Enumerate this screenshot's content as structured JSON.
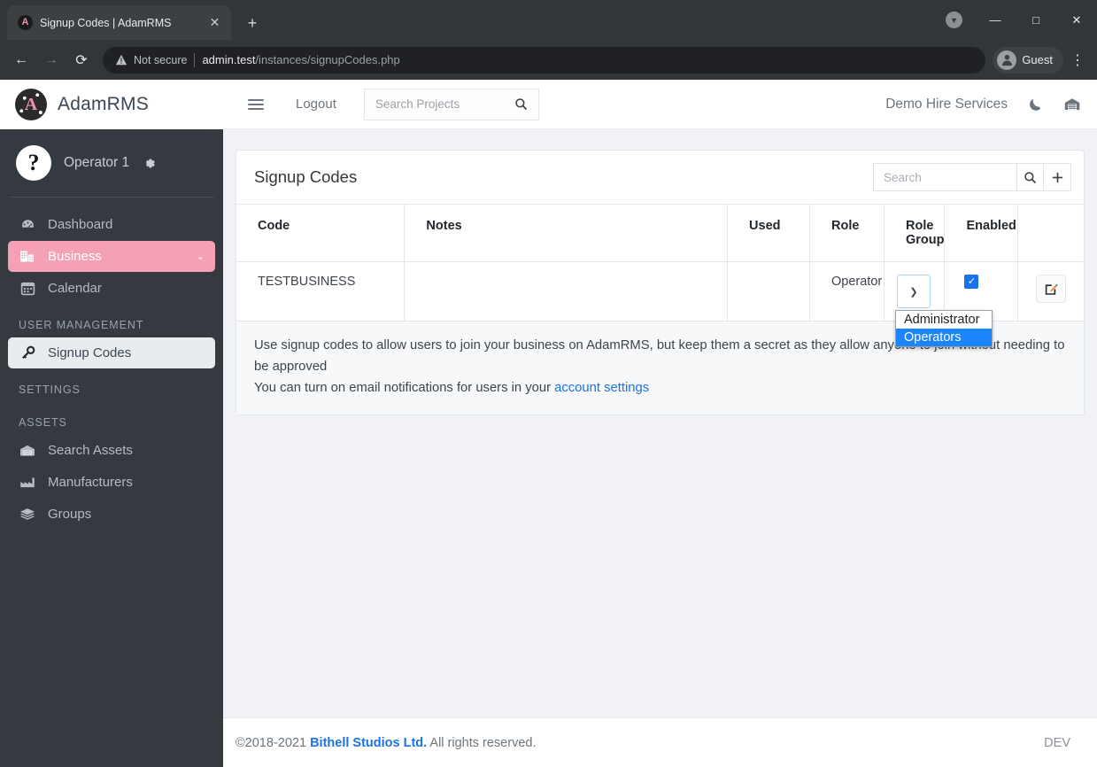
{
  "browser": {
    "tab": {
      "title": "Signup Codes | AdamRMS",
      "favicon_letter": "A",
      "close_icon": "close-icon"
    },
    "newtab_label": "+",
    "window": {
      "minimize": "—",
      "maximize": "□",
      "close": "✕",
      "update_icon": "update-dot-icon"
    },
    "nav": {
      "back": "←",
      "forward": "→",
      "reload": "⟳"
    },
    "omnibox": {
      "security_text": "Not secure",
      "url_host": "admin.test",
      "url_path": "/instances/signupCodes.php"
    },
    "profile_name": "Guest",
    "kebab_label": "⋮"
  },
  "sidebar": {
    "brand": {
      "name": "AdamRMS",
      "logo_letter": "A"
    },
    "user": {
      "name": "Operator 1",
      "avatar_glyph": "?",
      "settings_icon": "gear-icon"
    },
    "items": [
      {
        "label": "Dashboard",
        "icon": "dashboard-icon",
        "state": "normal"
      },
      {
        "label": "Business",
        "icon": "building-icon",
        "state": "active-pink",
        "chevron": "⌄"
      },
      {
        "label": "Calendar",
        "icon": "calendar-icon",
        "state": "normal"
      }
    ],
    "sections": [
      {
        "heading": "USER MANAGEMENT",
        "items": [
          {
            "label": "Signup Codes",
            "icon": "key-icon",
            "state": "active-light"
          }
        ]
      },
      {
        "heading": "SETTINGS",
        "items": []
      },
      {
        "heading": "ASSETS",
        "items": [
          {
            "label": "Search Assets",
            "icon": "warehouse-icon",
            "state": "normal"
          },
          {
            "label": "Manufacturers",
            "icon": "factory-icon",
            "state": "normal"
          },
          {
            "label": "Groups",
            "icon": "layers-icon",
            "state": "normal"
          }
        ]
      }
    ]
  },
  "topnav": {
    "menu_icon": "hamburger-icon",
    "logout_label": "Logout",
    "project_search_placeholder": "Search Projects",
    "search_icon": "search-icon",
    "business_name": "Demo Hire Services",
    "dark_mode_icon": "moon-icon",
    "venue_icon": "warehouse-icon"
  },
  "card": {
    "title": "Signup Codes",
    "search_placeholder": "Search",
    "search_value": "",
    "search_icon": "search-icon",
    "add_icon": "plus-icon",
    "columns": [
      "Code",
      "Notes",
      "Used",
      "Role",
      "Role Group",
      "Enabled",
      ""
    ],
    "rows": [
      {
        "code": "TESTBUSINESS",
        "notes": "",
        "used": "",
        "role": "Operator",
        "role_group_value": "",
        "enabled": true,
        "edit_icon": "edit-icon"
      }
    ],
    "dropdown": {
      "open": true,
      "options": [
        "Administrator",
        "Operators"
      ],
      "selected": "Operators"
    },
    "help_line1": "Use signup codes to allow users to join your business on AdamRMS, but keep them a secret as they allow anyone to join without needing to be approved",
    "help_line2_prefix": "You can turn on email notifications for users in your ",
    "help_link": "account settings"
  },
  "footer": {
    "copyright": "©2018-2021 ",
    "company": "Bithell Studios Ltd.",
    "rights": " All rights reserved.",
    "env": "DEV"
  },
  "colors": {
    "accent_pink": "#f4a0b5",
    "sidebar_bg": "#343a40",
    "link_blue": "#1a73e8",
    "highlight_blue": "#1a85ff"
  }
}
